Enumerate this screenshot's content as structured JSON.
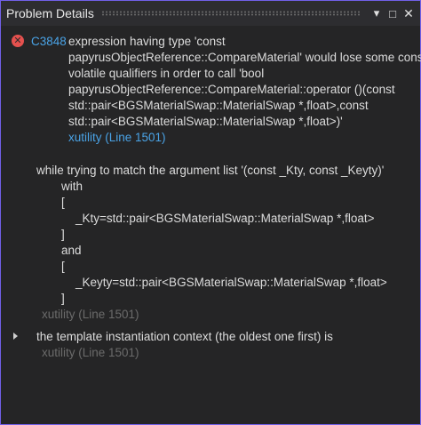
{
  "window": {
    "title": "Problem Details",
    "buttons": {
      "dropdown": "▾",
      "maximize": "□",
      "close": "✕"
    }
  },
  "error": {
    "icon": "error-icon",
    "code": "C3848",
    "message_lines": [
      "expression having type 'const",
      "papyrusObjectReference::CompareMaterial' would lose some const-",
      "volatile qualifiers in order to call 'bool",
      "papyrusObjectReference::CompareMaterial::operator ()(const",
      "std::pair<BGSMaterialSwap::MaterialSwap *,float>,const",
      "std::pair<BGSMaterialSwap::MaterialSwap *,float>)'"
    ],
    "location_link": "xutility (Line 1501)"
  },
  "detail": {
    "lines": [
      "while trying to match the argument list '(const _Kty, const _Keyty)'",
      "with",
      "[",
      "_Kty=std::pair<BGSMaterialSwap::MaterialSwap *,float>",
      "]",
      "and",
      "[",
      "_Keyty=std::pair<BGSMaterialSwap::MaterialSwap *,float>",
      "]"
    ],
    "location": "xutility (Line 1501)"
  },
  "context": {
    "label": "the template instantiation context (the oldest one first) is",
    "location": "xutility (Line 1501)"
  },
  "colors": {
    "accent_border": "#7160e8",
    "link": "#4aa3e6",
    "error_red": "#e5514e",
    "background": "#252526"
  }
}
